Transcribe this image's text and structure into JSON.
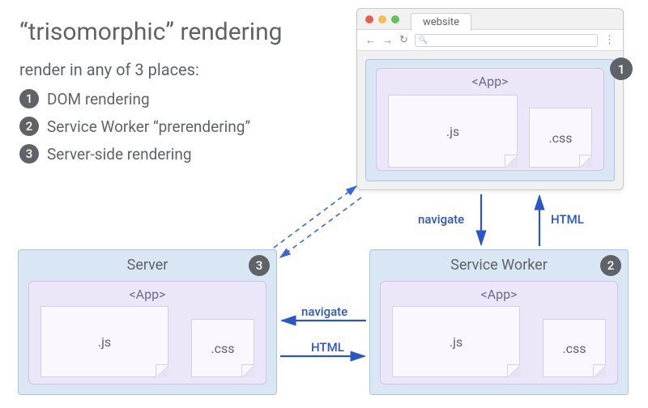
{
  "title": "“trisomorphic” rendering",
  "subtitle": "render in any of 3 places:",
  "list": [
    {
      "num": "1",
      "label": "DOM rendering"
    },
    {
      "num": "2",
      "label": "Service Worker “prerendering”"
    },
    {
      "num": "3",
      "label": "Server-side rendering"
    }
  ],
  "browser": {
    "tab": "website",
    "back": "←",
    "fwd": "→",
    "reload": "↻",
    "search_icon": "🔍",
    "menu": "⋮",
    "badge": "1",
    "app_label": "<App>",
    "js": ".js",
    "css": ".css",
    "traffic": {
      "red": "#e85f52",
      "yellow": "#f4bd4f",
      "green": "#65c15a"
    }
  },
  "server": {
    "label": "Server",
    "badge": "3",
    "app_label": "<App>",
    "js": ".js",
    "css": ".css"
  },
  "worker": {
    "label": "Service Worker",
    "badge": "2",
    "app_label": "<App>",
    "js": ".js",
    "css": ".css"
  },
  "arrows": {
    "navigate_down": "navigate",
    "html_up": "HTML",
    "navigate_left": "navigate",
    "html_right": "HTML"
  },
  "colors": {
    "arrow": "#2b56c6"
  }
}
